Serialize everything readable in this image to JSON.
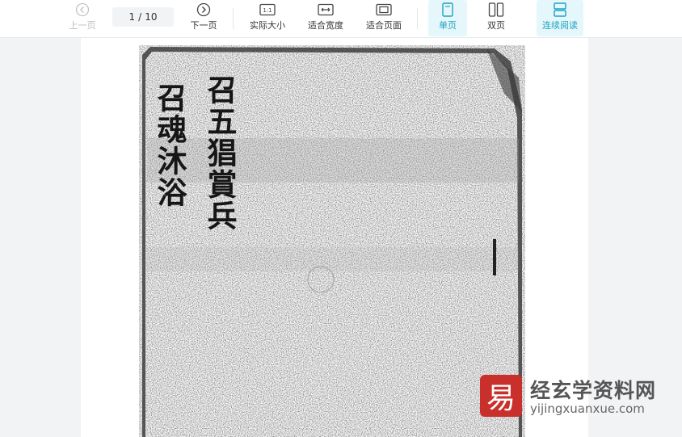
{
  "toolbar": {
    "prev_label": "上一页",
    "next_label": "下一页",
    "page_current": "1",
    "page_separator": "/",
    "page_total": "10",
    "actual_size_label": "实际大小",
    "actual_size_icon_text": "1:1",
    "fit_width_label": "适合宽度",
    "fit_page_label": "适合页面",
    "single_page_label": "单页",
    "double_page_label": "双页",
    "continuous_label": "连续阅读"
  },
  "document": {
    "column_1": "召五猖賞兵",
    "column_2": "召魂沐浴"
  },
  "watermark": {
    "logo_char": "易",
    "name": "经玄学资料网",
    "url": "yijingxuanxue.com"
  },
  "colors": {
    "accent": "#1aa3c2",
    "active_bg": "#e6f7fb",
    "watermark_red": "#c9302c"
  }
}
